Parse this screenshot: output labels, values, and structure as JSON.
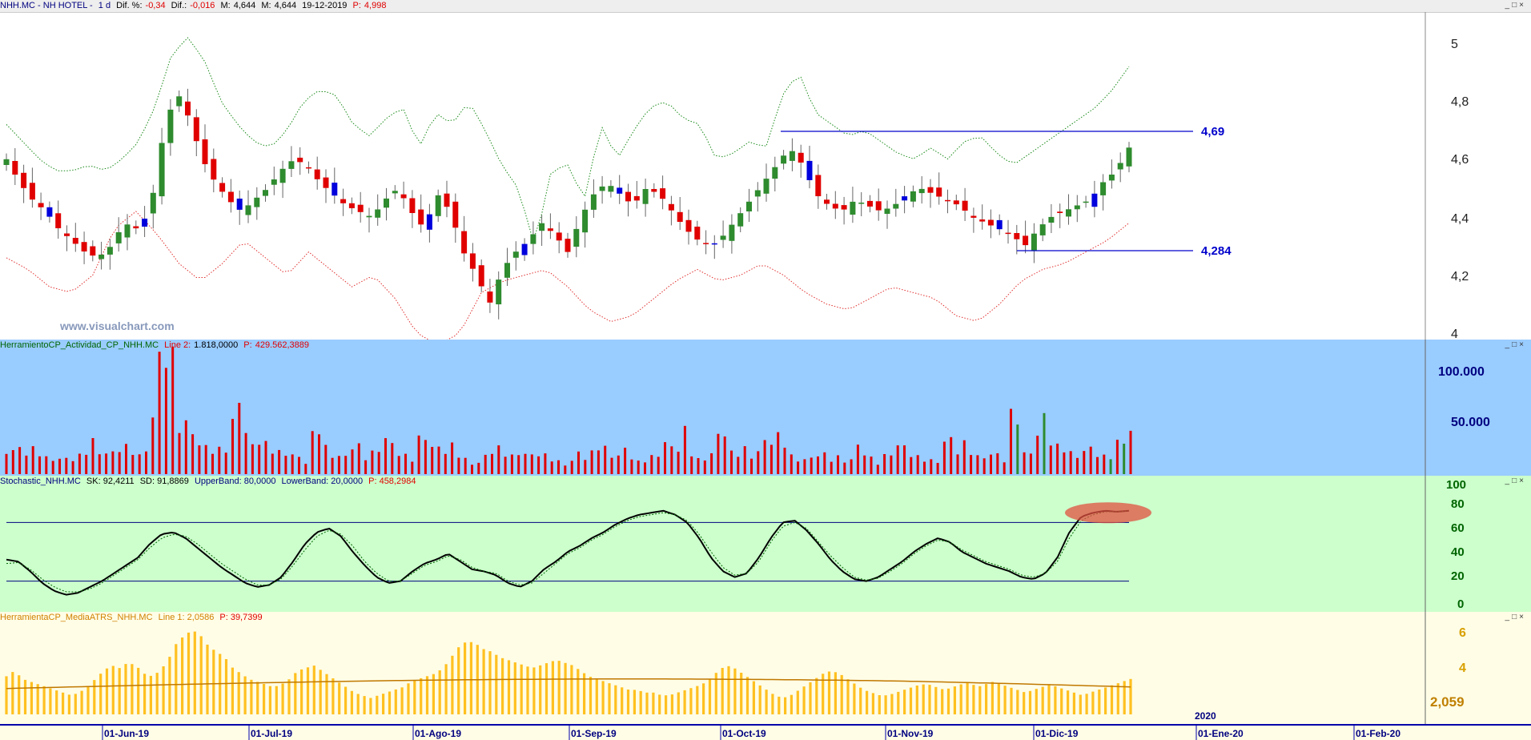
{
  "colors": {
    "up": "#2e8b2e",
    "down": "#e00000",
    "neutral": "#0000dd",
    "upper_band": "#1a8a1a",
    "lower_band": "#e03030",
    "level_line": "#0000cc",
    "volume_pane_bg": "#99ccff",
    "stoch_pane_bg": "#ccffcc",
    "atr_pane_bg": "#fffde6",
    "atr_bar": "#ffc020",
    "atr_avg": "#c07800",
    "highlight": "#e05040"
  },
  "window_controls": [
    "_",
    "□",
    "×"
  ],
  "price_pane": {
    "header": {
      "symbol": "NHH.MC - NH HOTEL -",
      "period": "1 d",
      "dif_pct_label": "Dif. %:",
      "dif_pct_value": "-0,34",
      "dif_label": "Dif.:",
      "dif_value": "-0,016",
      "m_label": "M:",
      "m_value": "4,644",
      "m2_label": "M:",
      "m2_value": "4,644",
      "date": "19-12-2019",
      "p_label": "P:",
      "p_value": "4,998"
    },
    "watermark": "www.visualchart.com",
    "level_high_label": "4,69",
    "level_low_label": "4,284",
    "yticks": [
      "5",
      "4,8",
      "4,6",
      "4,4",
      "4,2",
      "4"
    ]
  },
  "volume_pane": {
    "title": "HerramientoCP_Actividad_CP_NHH.MC",
    "line_label": "Line 2:",
    "line_value": "1.818,0000",
    "p_label": "P:",
    "p_value": "429.562,3889",
    "yticks": [
      "100.000",
      "50.000"
    ]
  },
  "stoch_pane": {
    "title": "Stochastic_NHH.MC",
    "sk": "SK: 92,4211",
    "sd": "SD: 91,8869",
    "upper": "UpperBand: 80,0000",
    "lower": "LowerBand: 20,0000",
    "p": "P: 458,2984",
    "yticks": [
      "100",
      "80",
      "60",
      "40",
      "20",
      "0"
    ]
  },
  "atr_pane": {
    "title": "HerramientaCP_MediaATRS_NHH.MC",
    "line": "Line 1: 2,0586",
    "p": "P: 39,7399",
    "last_value_label": "2,059",
    "yticks": [
      "6",
      "4"
    ],
    "year_label": "2020"
  },
  "x_axis": {
    "labels": [
      "01-Jun-19",
      "01-Jul-19",
      "01-Ago-19",
      "01-Sep-19",
      "01-Oct-19",
      "01-Nov-19",
      "01-Dic-19",
      "01-Ene-20",
      "01-Feb-20"
    ]
  },
  "chart_data": [
    {
      "type": "candlestick",
      "title": "NHH.MC - NH HOTEL - 1 d",
      "ylim": [
        4.0,
        5.1
      ],
      "x_labels": [
        "01-Jun-19",
        "01-Jul-19",
        "01-Ago-19",
        "01-Sep-19",
        "01-Oct-19",
        "01-Nov-19",
        "01-Dic-19",
        "01-Ene-20",
        "01-Feb-20"
      ],
      "close_path": [
        4.6,
        4.52,
        4.46,
        4.42,
        4.36,
        4.32,
        4.28,
        4.26,
        4.3,
        4.38,
        4.36,
        4.42,
        4.68,
        4.84,
        4.74,
        4.6,
        4.52,
        4.46,
        4.42,
        4.46,
        4.5,
        4.56,
        4.6,
        4.58,
        4.52,
        4.48,
        4.44,
        4.42,
        4.4,
        4.46,
        4.5,
        4.42,
        4.36,
        4.48,
        4.42,
        4.28,
        4.2,
        4.1,
        4.22,
        4.28,
        4.32,
        4.38,
        4.34,
        4.28,
        4.4,
        4.48,
        4.52,
        4.48,
        4.44,
        4.5,
        4.48,
        4.42,
        4.36,
        4.32,
        4.3,
        4.34,
        4.4,
        4.46,
        4.52,
        4.58,
        4.64,
        4.58,
        4.48,
        4.44,
        4.42,
        4.46,
        4.44,
        4.42,
        4.44,
        4.48,
        4.5,
        4.48,
        4.46,
        4.44,
        4.4,
        4.38,
        4.36,
        4.34,
        4.3,
        4.36,
        4.4,
        4.42,
        4.44,
        4.46,
        4.52,
        4.56,
        4.64
      ],
      "upper_band_path": [
        4.72,
        4.66,
        4.6,
        4.56,
        4.56,
        4.58,
        4.56,
        4.6,
        4.66,
        4.78,
        4.96,
        5.02,
        4.94,
        4.8,
        4.72,
        4.66,
        4.64,
        4.7,
        4.8,
        4.84,
        4.82,
        4.72,
        4.68,
        4.74,
        4.78,
        4.64,
        4.76,
        4.72,
        4.8,
        4.7,
        4.58,
        4.5,
        4.3,
        4.56,
        4.58,
        4.46,
        4.72,
        4.6,
        4.7,
        4.78,
        4.8,
        4.74,
        4.72,
        4.6,
        4.62,
        4.66,
        4.64,
        4.82,
        4.9,
        4.76,
        4.72,
        4.68,
        4.7,
        4.66,
        4.62,
        4.6,
        4.64,
        4.6,
        4.66,
        4.68,
        4.62,
        4.58,
        4.62,
        4.66,
        4.7,
        4.74,
        4.78,
        4.84,
        4.92
      ],
      "lower_band_path": [
        4.26,
        4.22,
        4.16,
        4.14,
        4.2,
        4.36,
        4.42,
        4.34,
        4.24,
        4.18,
        4.24,
        4.32,
        4.26,
        4.2,
        4.28,
        4.22,
        4.16,
        4.2,
        4.12,
        4.0,
        3.96,
        4.0,
        4.14,
        4.18,
        4.2,
        4.22,
        4.16,
        4.08,
        4.04,
        4.06,
        4.12,
        4.18,
        4.22,
        4.18,
        4.2,
        4.24,
        4.2,
        4.14,
        4.1,
        4.08,
        4.12,
        4.16,
        4.14,
        4.12,
        4.06,
        4.04,
        4.1,
        4.18,
        4.22,
        4.24,
        4.28,
        4.32,
        4.38
      ],
      "levels": [
        4.69,
        4.284
      ]
    },
    {
      "type": "bar",
      "title": "HerramientoCP_Actividad_CP_NHH.MC",
      "ylim": [
        0,
        130000
      ],
      "profile": [
        30,
        25,
        22,
        28,
        18,
        20,
        14,
        16,
        22,
        38,
        24,
        20,
        30,
        26,
        18,
        56,
        122,
        136,
        40,
        68,
        28,
        24,
        26,
        30,
        108,
        20,
        36,
        30,
        24,
        28,
        16,
        12,
        62,
        28,
        22,
        16,
        36,
        18,
        26,
        42,
        24,
        20,
        16,
        58,
        28,
        22,
        30,
        18,
        14,
        12,
        24,
        28,
        18,
        30,
        16,
        22,
        18,
        14,
        12,
        20,
        16,
        32,
        28,
        20,
        24,
        12,
        16,
        22,
        36,
        18,
        46,
        14,
        20,
        24,
        50,
        16,
        30,
        22,
        28,
        36,
        42,
        20,
        18,
        14,
        24,
        16,
        20,
        14,
        28,
        18,
        12,
        26,
        32,
        22,
        18,
        16,
        14,
        42,
        22,
        34,
        18,
        24,
        20,
        14,
        88,
        22,
        34,
        56,
        28,
        30,
        22,
        26,
        24,
        18,
        20,
        44,
        48
      ]
    },
    {
      "type": "line",
      "title": "Stochastic_NHH.MC",
      "ylim": [
        0,
        100
      ],
      "series": [
        {
          "name": "SK",
          "values": [
            42,
            40,
            30,
            18,
            10,
            6,
            8,
            14,
            20,
            28,
            36,
            44,
            58,
            68,
            70,
            64,
            54,
            44,
            34,
            26,
            18,
            14,
            16,
            24,
            40,
            58,
            70,
            74,
            66,
            50,
            36,
            24,
            18,
            20,
            30,
            38,
            42,
            48,
            40,
            32,
            30,
            26,
            18,
            14,
            20,
            32,
            40,
            50,
            56,
            64,
            70,
            78,
            84,
            88,
            90,
            92,
            88,
            80,
            64,
            44,
            30,
            24,
            28,
            44,
            64,
            80,
            82,
            72,
            58,
            42,
            30,
            22,
            20,
            24,
            32,
            40,
            50,
            58,
            64,
            60,
            50,
            44,
            38,
            34,
            30,
            24,
            22,
            28,
            44,
            70,
            86,
            90,
            92,
            91,
            92
          ]
        },
        {
          "name": "SD",
          "values": [
            38,
            39,
            32,
            22,
            14,
            9,
            9,
            12,
            18,
            26,
            34,
            42,
            54,
            64,
            68,
            66,
            58,
            48,
            38,
            30,
            22,
            16,
            16,
            22,
            36,
            52,
            66,
            72,
            68,
            56,
            40,
            28,
            20,
            20,
            28,
            36,
            40,
            46,
            42,
            34,
            30,
            28,
            20,
            16,
            18,
            28,
            38,
            48,
            54,
            62,
            68,
            76,
            82,
            86,
            88,
            90,
            88,
            82,
            68,
            50,
            34,
            26,
            28,
            40,
            60,
            76,
            80,
            74,
            60,
            46,
            34,
            24,
            21,
            23,
            30,
            38,
            48,
            56,
            62,
            60,
            52,
            46,
            40,
            36,
            32,
            26,
            24,
            28,
            40,
            64,
            82,
            88,
            91,
            91,
            92
          ]
        }
      ],
      "bands": [
        80,
        20
      ],
      "last_sk": 92.4211,
      "last_sd": 91.8869
    },
    {
      "type": "bar",
      "title": "HerramientaCP_MediaATRS_NHH.MC",
      "ylim": [
        0,
        6.6
      ],
      "avg_line": 2.0586,
      "profile": [
        2.8,
        3.2,
        2.6,
        2.4,
        2.2,
        2.0,
        1.8,
        1.6,
        1.4,
        1.6,
        2.0,
        2.6,
        3.2,
        3.6,
        3.4,
        3.8,
        3.6,
        3.0,
        2.8,
        3.2,
        4.0,
        5.2,
        5.8,
        6.2,
        5.8,
        5.0,
        4.6,
        4.2,
        3.4,
        3.0,
        2.6,
        2.4,
        2.2,
        2.0,
        2.2,
        2.6,
        3.2,
        3.4,
        3.6,
        3.2,
        2.8,
        2.4,
        2.0,
        1.6,
        1.4,
        1.2,
        1.4,
        1.6,
        1.8,
        2.0,
        2.4,
        2.6,
        2.8,
        3.0,
        3.4,
        4.2,
        5.0,
        5.4,
        5.2,
        4.8,
        4.6,
        4.2,
        4.0,
        3.8,
        3.6,
        3.4,
        3.6,
        3.8,
        4.0,
        3.8,
        3.6,
        3.2,
        2.8,
        2.6,
        2.4,
        2.2,
        2.0,
        1.8,
        1.8,
        1.6,
        1.6,
        1.4,
        1.4,
        1.6,
        1.8,
        2.0,
        2.2,
        2.6,
        3.2,
        3.6,
        3.4,
        3.0,
        2.6,
        2.2,
        1.8,
        1.4,
        1.2,
        1.4,
        1.8,
        2.2,
        2.6,
        3.0,
        3.2,
        3.0,
        2.6,
        2.2,
        1.8,
        1.6,
        1.4,
        1.4,
        1.6,
        1.8,
        2.0,
        2.2,
        2.2,
        2.0,
        1.8,
        2.0,
        2.2,
        2.4,
        2.0,
        2.2,
        2.4,
        2.2,
        2.0,
        1.8,
        1.6,
        1.8,
        2.0,
        2.2,
        2.0,
        1.8,
        1.6,
        1.4,
        1.6,
        1.8,
        2.0,
        2.2,
        2.4,
        2.6
      ]
    }
  ]
}
